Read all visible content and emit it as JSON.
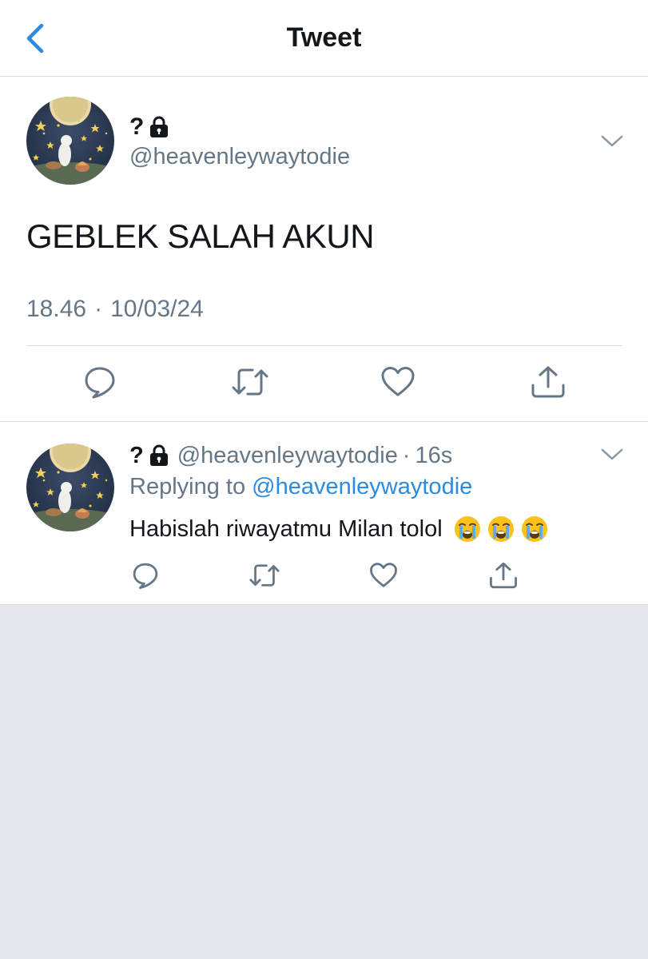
{
  "nav": {
    "title": "Tweet",
    "back_icon": "chevron-left-icon"
  },
  "colors": {
    "accent": "#2b8be0",
    "text": "#14171a",
    "secondary": "#657786",
    "background": "#e6e7ec"
  },
  "main_tweet": {
    "display_name": "?",
    "handle": "@heavenleywaytodie",
    "text": "GEBLEK SALAH AKUN",
    "time": "18.46",
    "separator": "·",
    "date": "10/03/24",
    "icons": [
      "lock-icon",
      "chevron-down-icon",
      "reply-icon",
      "retweet-icon",
      "like-icon",
      "share-icon"
    ]
  },
  "reply_tweet": {
    "display_name": "?",
    "handle": "@heavenleywaytodie",
    "separator": "·",
    "age": "16s",
    "replying_prefix": "Replying to",
    "replying_to": "@heavenleywaytodie",
    "text": "Habislah riwayatmu Milan tolol",
    "emojis": [
      "loudly-crying-face-icon",
      "loudly-crying-face-icon",
      "loudly-crying-face-icon"
    ]
  }
}
